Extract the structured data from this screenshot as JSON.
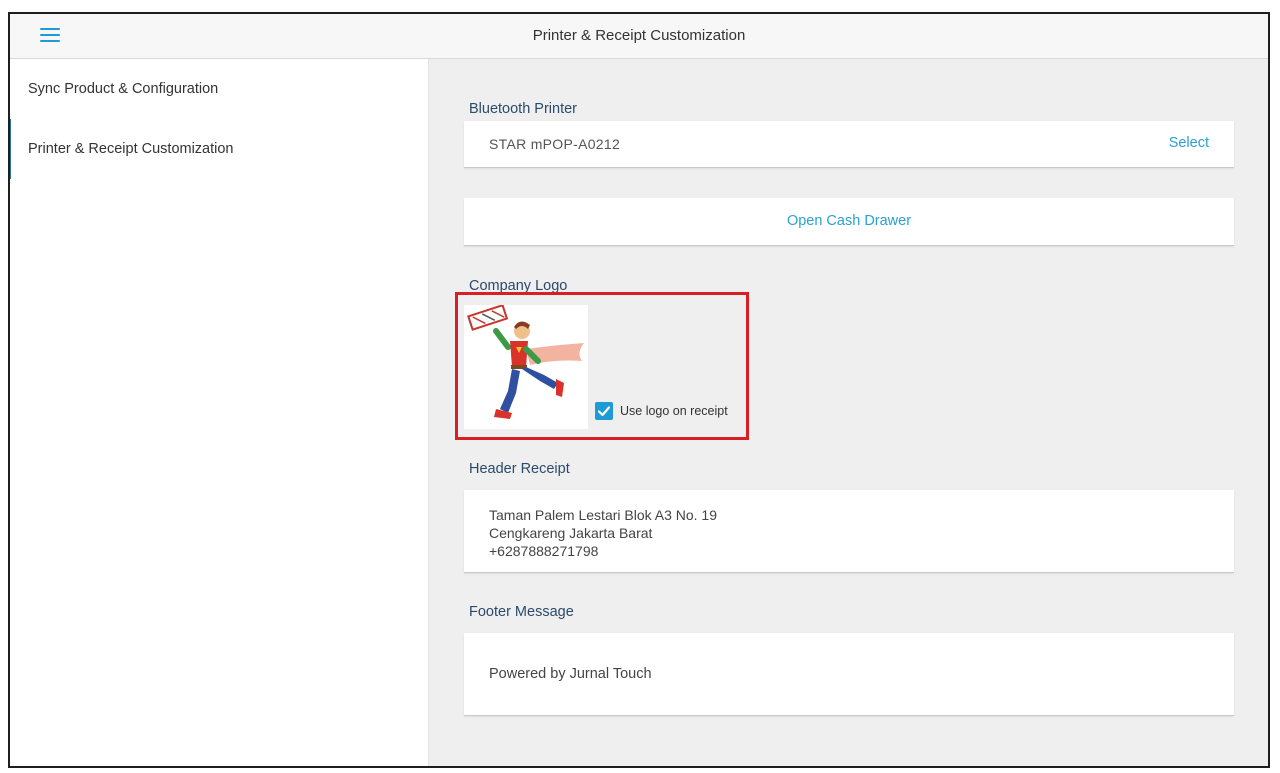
{
  "header": {
    "title": "Printer & Receipt Customization",
    "menu_icon": "hamburger-menu-icon"
  },
  "sidebar": {
    "items": [
      {
        "label": "Sync Product & Configuration",
        "active": false
      },
      {
        "label": "Printer & Receipt Customization",
        "active": true
      }
    ]
  },
  "bluetooth_printer": {
    "label": "Bluetooth Printer",
    "device_name": "STAR mPOP-A0212",
    "select_label": "Select"
  },
  "cash_drawer": {
    "button_label": "Open Cash Drawer"
  },
  "company_logo": {
    "label": "Company Logo",
    "use_logo_label": "Use logo on receipt",
    "use_logo_checked": true
  },
  "header_receipt": {
    "label": "Header Receipt",
    "lines": [
      "Taman Palem Lestari Blok A3 No. 19",
      "Cengkareng Jakarta Barat",
      "+6287888271798"
    ]
  },
  "footer_message": {
    "label": "Footer Message",
    "text": "Powered by Jurnal Touch"
  },
  "colors": {
    "accent": "#1e9bd7",
    "link": "#2aa0d4",
    "highlight_border": "#d81f26",
    "active_indicator": "#2c6fb2"
  }
}
